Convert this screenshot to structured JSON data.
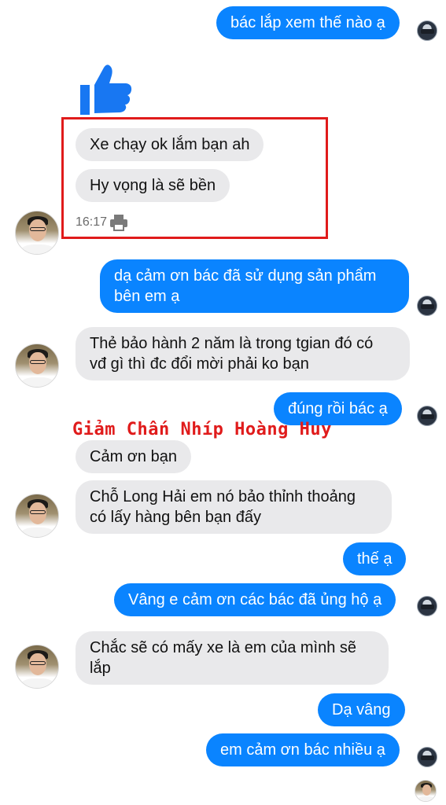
{
  "messages": {
    "m1": "bác lắp xem thế nào ạ",
    "m2": "Xe chạy ok lắm bạn ah",
    "m3": "Hy vọng là sẽ bền",
    "m4_line1": "dạ cảm ơn bác đã sử dụng sản phẩm",
    "m4_line2": "bên em ạ",
    "m5_line1": "Thẻ bảo hành 2 năm là trong tgian đó có",
    "m5_line2": "vđ gì thì đc đổi mời phải ko bạn",
    "m6": "đúng rồi bác ạ",
    "m7": "Cảm ơn bạn",
    "m8_line1": "Chỗ Long Hải em nó bảo thỉnh thoảng",
    "m8_line2": "có lấy hàng bên bạn đấy",
    "m9": "thế ạ",
    "m10": "Vâng e cảm ơn các bác đã ủng hộ ạ",
    "m11_line1": "Chắc sẽ có mấy xe là em của mình sẽ",
    "m11_line2": "lắp",
    "m12": "Dạ vâng",
    "m13": "em cảm ơn bác nhiều ạ"
  },
  "timestamp": "16:17",
  "watermark": "Giảm Chấn Nhíp Hoàng Huy",
  "colors": {
    "outgoing_bubble": "#0a84ff",
    "incoming_bubble": "#e9e9eb",
    "highlight_box": "#e01b1b",
    "thumb_icon": "#1877f2"
  },
  "icons": [
    "thumbs-up-icon",
    "printer-icon"
  ]
}
